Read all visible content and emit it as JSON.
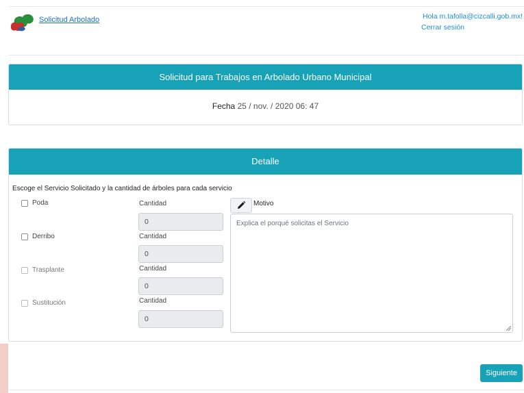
{
  "header": {
    "app_link": "Solicitud Arbolado",
    "greeting": "Hola m.tafolla@cizcalli.gob.mx!",
    "logout": "Cerrar sesión"
  },
  "card1": {
    "title": "Solicitud para Trabajos en Arbolado Urbano Municipal",
    "fecha_label": "Fecha",
    "fecha_value": "25 / nov. / 2020 06: 47"
  },
  "card2": {
    "title": "Detalle",
    "instructions": "Escoge el Servicio Solicitado y la cantidad de árboles para cada servicio",
    "services": [
      {
        "label": "Poda",
        "qty_label": "Cantidad",
        "qty_value": "0"
      },
      {
        "label": "Derribo",
        "qty_label": "Cantidad",
        "qty_value": "0"
      },
      {
        "label": "Trasplante",
        "qty_label": "Cantidad",
        "qty_value": "0"
      },
      {
        "label": "Sustitución",
        "qty_label": "Cantidad",
        "qty_value": "0"
      }
    ],
    "motivo_label": "Motivo",
    "motivo_placeholder": "Explica el porqué solicitas el Servicio"
  },
  "actions": {
    "next": "Siguiente"
  },
  "colors": {
    "accent": "#17a2b8",
    "link": "#1a6fd4"
  },
  "icons": [
    "logo-icon",
    "pencil-icon"
  ]
}
